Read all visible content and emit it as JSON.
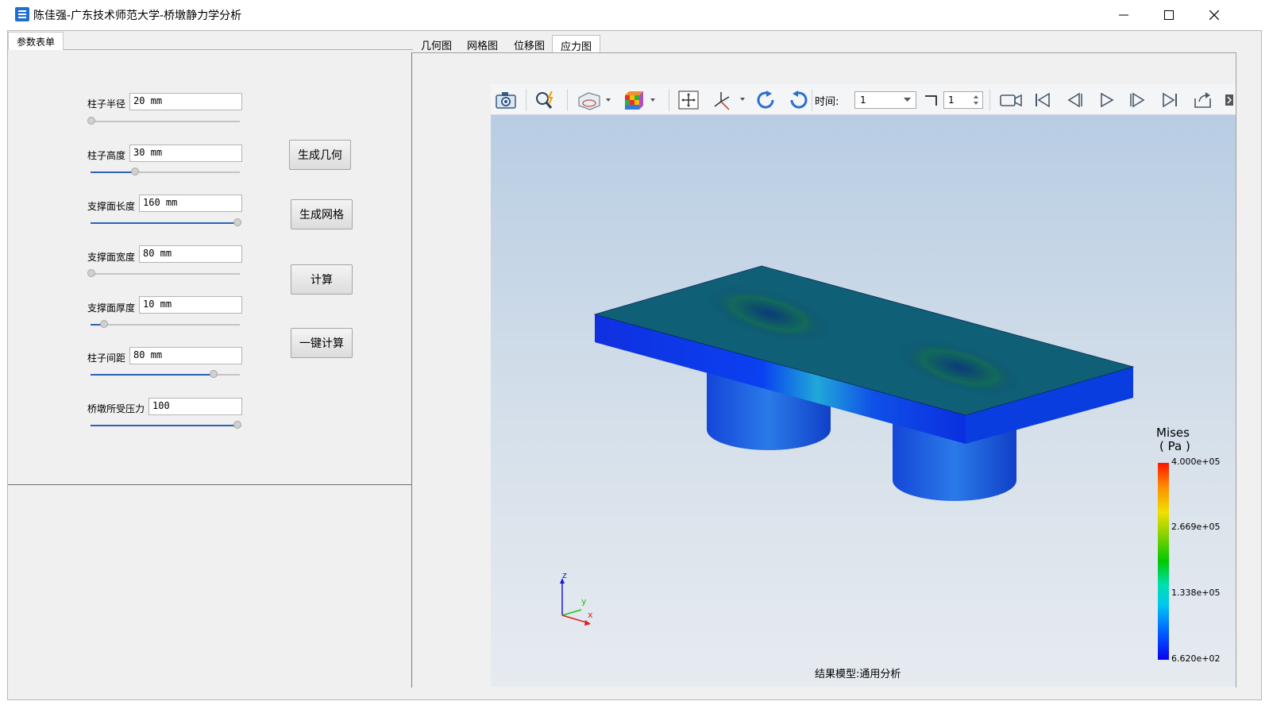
{
  "window": {
    "title": "陈佳强-广东技术师范大学-桥墩静力学分析",
    "minimize": "minimize",
    "maximize": "maximize",
    "close": "close"
  },
  "left_panel": {
    "tab": "参数表单",
    "params": [
      {
        "label": "柱子半径",
        "value": "20 mm",
        "slider_fraction": 0.0
      },
      {
        "label": "柱子高度",
        "value": "30 mm",
        "slider_fraction": 0.3
      },
      {
        "label": "支撑面长度",
        "value": "160 mm",
        "slider_fraction": 1.0
      },
      {
        "label": "支撑面宽度",
        "value": "80 mm",
        "slider_fraction": 0.0
      },
      {
        "label": "支撑面厚度",
        "value": "10 mm",
        "slider_fraction": 0.09
      },
      {
        "label": "柱子间距",
        "value": "80 mm",
        "slider_fraction": 0.83
      },
      {
        "label": "桥墩所受压力",
        "value": "100",
        "slider_fraction": 1.0
      }
    ],
    "buttons": {
      "gen_geometry": "生成几何",
      "gen_mesh": "生成网格",
      "compute": "计算",
      "one_click": "一键计算"
    }
  },
  "right_panel": {
    "tabs": [
      "几何图",
      "网格图",
      "位移图",
      "应力图"
    ],
    "active_tab": "应力图"
  },
  "toolbar": {
    "icons": [
      "camera-icon",
      "zoom-icon",
      "display-mode-icon",
      "color-cube-icon",
      "fit-view-icon",
      "axis-triad-icon",
      "rotate-cw-icon",
      "rotate-ccw-icon",
      "record-video-icon",
      "first-frame-icon",
      "prev-frame-icon",
      "play-icon",
      "next-frame-icon",
      "last-frame-icon",
      "export-icon"
    ],
    "time_label": "时间:",
    "time_value": "1",
    "step_value": "1"
  },
  "legend": {
    "title_line1": "Mises",
    "title_line2": "( Pa )",
    "values": [
      "4.000e+05",
      "2.669e+05",
      "1.338e+05",
      "6.620e+02"
    ],
    "colors": [
      "#ff1400",
      "#f0e000",
      "#00c800",
      "#00c8f0",
      "#0a00f0"
    ]
  },
  "axes": {
    "z": "z",
    "y": "y",
    "x": "x"
  },
  "status": "结果模型:通用分析"
}
